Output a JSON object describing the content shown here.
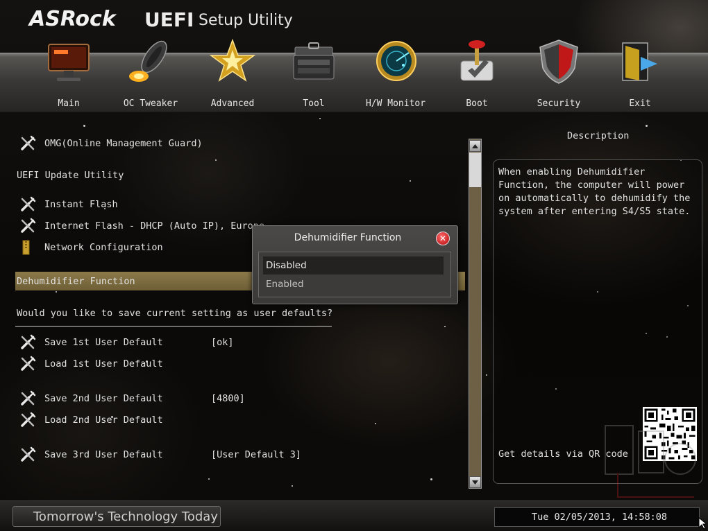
{
  "header": {
    "brand": "ASRock",
    "product": "UEFI",
    "subtitle": "Setup Utility"
  },
  "nav": {
    "tabs": [
      {
        "label": "Main",
        "icon": "monitor-icon"
      },
      {
        "label": "OC Tweaker",
        "icon": "rocket-icon"
      },
      {
        "label": "Advanced",
        "icon": "star-icon"
      },
      {
        "label": "Tool",
        "icon": "toolbox-icon"
      },
      {
        "label": "H/W Monitor",
        "icon": "radar-icon"
      },
      {
        "label": "Boot",
        "icon": "joystick-icon"
      },
      {
        "label": "Security",
        "icon": "shield-icon"
      },
      {
        "label": "Exit",
        "icon": "exit-door-icon"
      }
    ],
    "active_tab": "Tool"
  },
  "tool_menu": {
    "items": [
      {
        "label": "OMG(Online Management Guard)",
        "icon": "wrench-icon",
        "value": ""
      },
      {
        "label": "UEFI Update Utility",
        "icon": "",
        "value": ""
      },
      {
        "label": "Instant Flash",
        "icon": "wrench-icon",
        "value": ""
      },
      {
        "label": "Internet Flash - DHCP (Auto IP), Europe",
        "icon": "wrench-icon",
        "value": ""
      },
      {
        "label": "Network Configuration",
        "icon": "folder-icon",
        "value": ""
      },
      {
        "label": "Dehumidifier Function",
        "icon": "",
        "value": ""
      },
      {
        "label": "Would you like to save current setting as user defaults?",
        "icon": "",
        "value": ""
      },
      {
        "label": "Save 1st User Default",
        "icon": "wrench-icon",
        "value": "[ok]"
      },
      {
        "label": "Load 1st User Default",
        "icon": "wrench-icon",
        "value": ""
      },
      {
        "label": "Save 2nd User Default",
        "icon": "wrench-icon",
        "value": "[4800]"
      },
      {
        "label": "Load 2nd User Default",
        "icon": "wrench-icon",
        "value": ""
      },
      {
        "label": "Save 3rd User Default",
        "icon": "wrench-icon",
        "value": "[User Default 3]"
      }
    ]
  },
  "description": {
    "title": "Description",
    "text": "When enabling Dehumidifier Function, the computer will power on automatically to dehumidify the system after entering S4/S5 state.",
    "qr_text": "Get details via QR code"
  },
  "popup": {
    "title": "Dehumidifier Function",
    "options": [
      "Disabled",
      "Enabled"
    ],
    "selected": "Disabled"
  },
  "footer": {
    "tagline": "Tomorrow's Technology Today",
    "datetime": "Tue 02/05/2013, 14:58:08"
  },
  "colors": {
    "highlight": "#8c7a4a",
    "scroll_track": "#6e6044",
    "close_red": "#b3070b"
  }
}
